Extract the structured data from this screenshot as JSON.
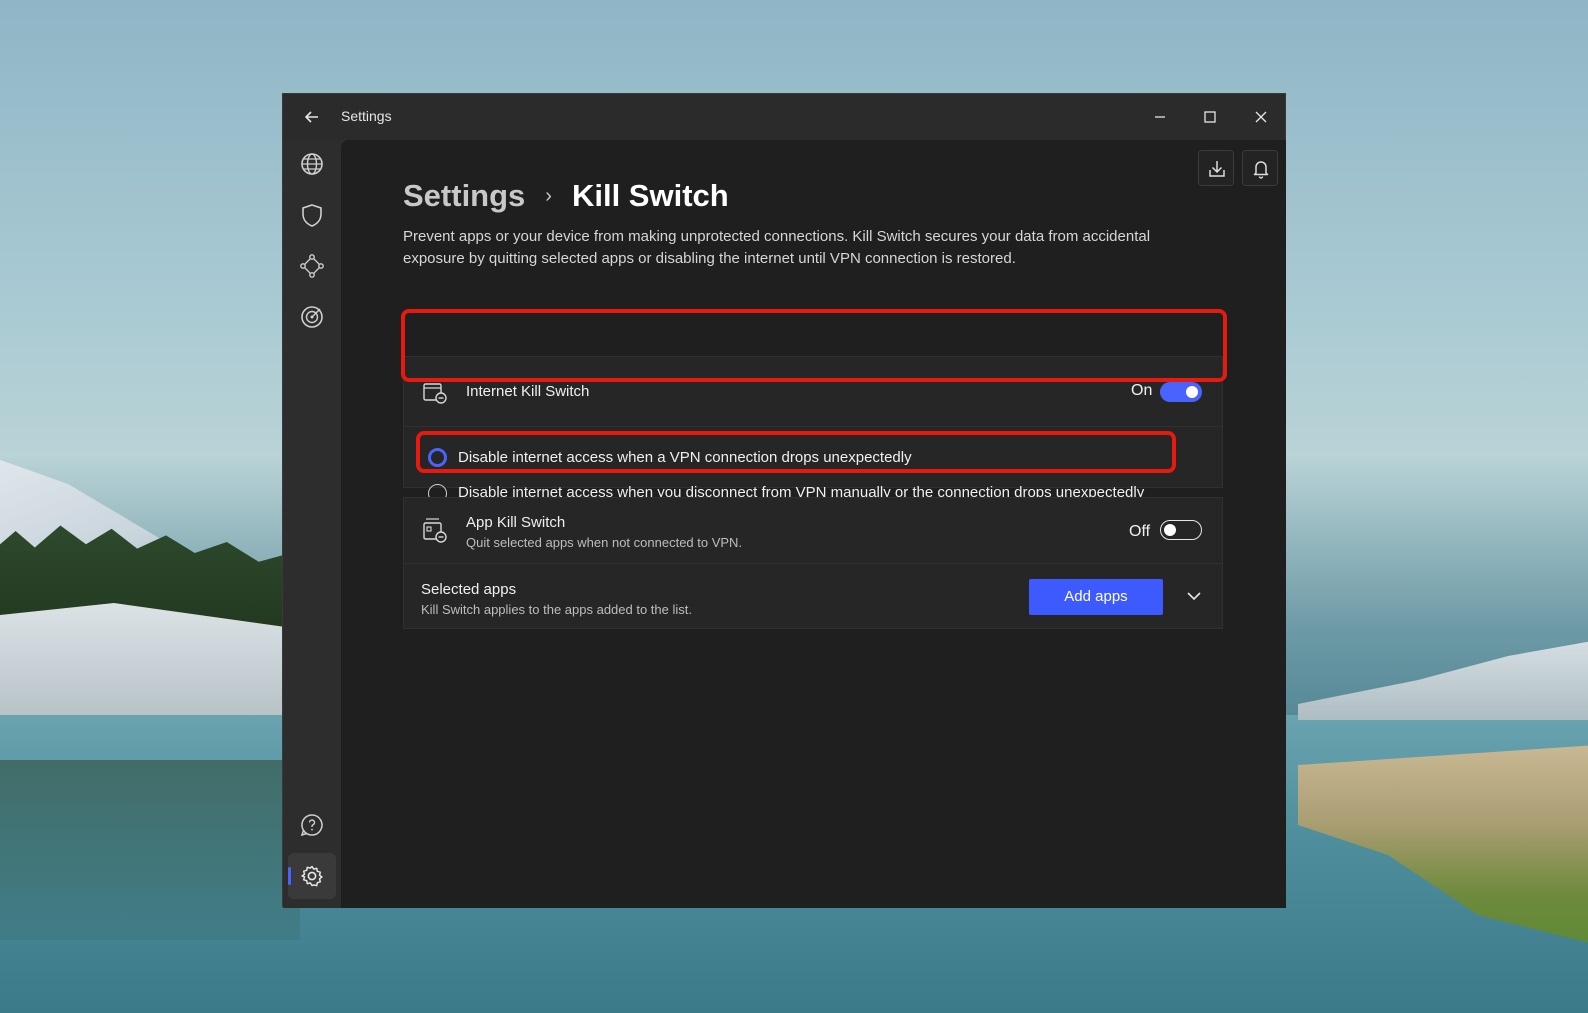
{
  "window": {
    "title": "Settings"
  },
  "titlebar_icons": {
    "back": "back-arrow-icon",
    "minimize": "minimize-icon",
    "maximize": "maximize-icon",
    "close": "close-icon"
  },
  "sidebar": {
    "items": [
      {
        "name": "globe-icon"
      },
      {
        "name": "shield-icon"
      },
      {
        "name": "meshnet-icon"
      },
      {
        "name": "radar-icon"
      },
      {
        "name": "help-icon"
      },
      {
        "name": "settings-gear-icon",
        "active": true
      }
    ]
  },
  "header_icons": [
    "download-icon",
    "bell-icon"
  ],
  "breadcrumb": {
    "parent": "Settings",
    "separator": "›",
    "current": "Kill Switch"
  },
  "description": "Prevent apps or your device from making unprotected connections. Kill Switch secures your data from accidental exposure by quitting selected apps or disabling the internet until VPN connection is restored.",
  "internet_kill_switch": {
    "title": "Internet Kill Switch",
    "state_label": "On",
    "enabled": true,
    "options": [
      {
        "label": "Disable internet access when a VPN connection drops unexpectedly",
        "selected": true
      },
      {
        "label": "Disable internet access when you disconnect from VPN manually or the connection drops unexpectedly",
        "selected": false
      }
    ]
  },
  "app_kill_switch": {
    "title": "App Kill Switch",
    "subtitle": "Quit selected apps when not connected to VPN.",
    "state_label": "Off",
    "enabled": false
  },
  "selected_apps": {
    "title": "Selected apps",
    "subtitle": "Kill Switch applies to the apps added to the list.",
    "button_label": "Add apps"
  },
  "colors": {
    "accent": "#4a63ff",
    "highlight": "#e8190f",
    "content_bg": "#1f1f1f"
  }
}
